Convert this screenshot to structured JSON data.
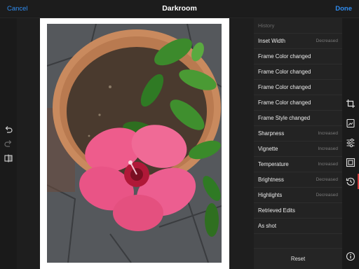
{
  "header": {
    "cancel_label": "Cancel",
    "title": "Darkroom",
    "done_label": "Done"
  },
  "left_toolbar": {
    "tools": [
      "undo-icon",
      "redo-icon",
      "compare-icon"
    ]
  },
  "history": {
    "heading": "History",
    "items": [
      {
        "label": "Inset Width",
        "value": "Decreased"
      },
      {
        "label": "Frame Color changed",
        "value": ""
      },
      {
        "label": "Frame Color changed",
        "value": ""
      },
      {
        "label": "Frame Color changed",
        "value": ""
      },
      {
        "label": "Frame Color changed",
        "value": ""
      },
      {
        "label": "Frame Style changed",
        "value": ""
      },
      {
        "label": "Sharpness",
        "value": "Increased"
      },
      {
        "label": "Vignette",
        "value": "Increased"
      },
      {
        "label": "Temperature",
        "value": "Increased"
      },
      {
        "label": "Brightness",
        "value": "Decreased"
      },
      {
        "label": "Highlights",
        "value": "Decreased"
      },
      {
        "label": "Retrieved Edits",
        "value": ""
      },
      {
        "label": "As shot",
        "value": ""
      }
    ],
    "reset_label": "Reset"
  },
  "right_toolbar": {
    "tools": [
      "crop-icon",
      "filters-icon",
      "adjust-sliders-icon",
      "frame-icon",
      "history-icon",
      "info-icon"
    ],
    "active_tool": "history-icon",
    "active_color": "#d33b3b"
  },
  "colors": {
    "accent": "#2f8cf0",
    "background": "#141414",
    "panel": "#232323"
  }
}
